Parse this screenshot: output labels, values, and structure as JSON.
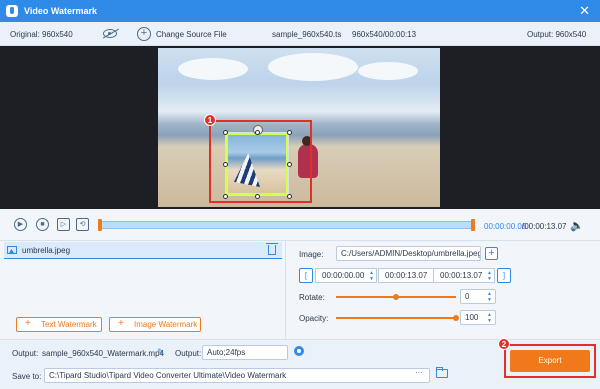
{
  "window": {
    "title": "Video Watermark",
    "close_glyph": "✕"
  },
  "info": {
    "original": "Original: 960x540",
    "change_source": "Change Source File",
    "filename": "sample_960x540.ts",
    "meta": "960x540/00:00:13",
    "output": "Output: 960x540"
  },
  "badges": {
    "one": "1",
    "two": "2"
  },
  "player": {
    "play_icon": "▶",
    "stop_icon": "■",
    "next_icon": "▷",
    "loop_icon": "⟲",
    "current_time": "00:00:00.00",
    "total_time": "/00:00:13.07",
    "volume_icon": "🔈"
  },
  "list": {
    "item": "umbrella.jpeg"
  },
  "buttons": {
    "text_watermark": "Text Watermark",
    "image_watermark": "Image Watermark",
    "export": "Export"
  },
  "properties": {
    "image_label": "Image:",
    "image_path": "C:/Users/ADMIN/Desktop/umbrella.jpeg",
    "plus": "+",
    "bracket_open": "[",
    "bracket_close": "]",
    "start": "00:00:00.00",
    "end": "00:00:13.07",
    "duration": "00:00:13.07",
    "rotate_label": "Rotate:",
    "rotate_value": "0",
    "rotate_fraction": 0.5,
    "opacity_label": "Opacity:",
    "opacity_value": "100",
    "opacity_fraction": 1.0
  },
  "bottom": {
    "output_label": "Output:",
    "output_file": "sample_960x540_Watermark.mp4",
    "output_label2": "Output:",
    "output_format": "Auto;24fps",
    "save_label": "Save to:",
    "save_path": "C:\\Tipard Studio\\Tipard Video Converter Ultimate\\Video Watermark",
    "dots": "···",
    "pencil": "✎"
  },
  "colors": {
    "accent": "#2f8ae8",
    "orange": "#f07a1a",
    "red": "#e0302a"
  }
}
